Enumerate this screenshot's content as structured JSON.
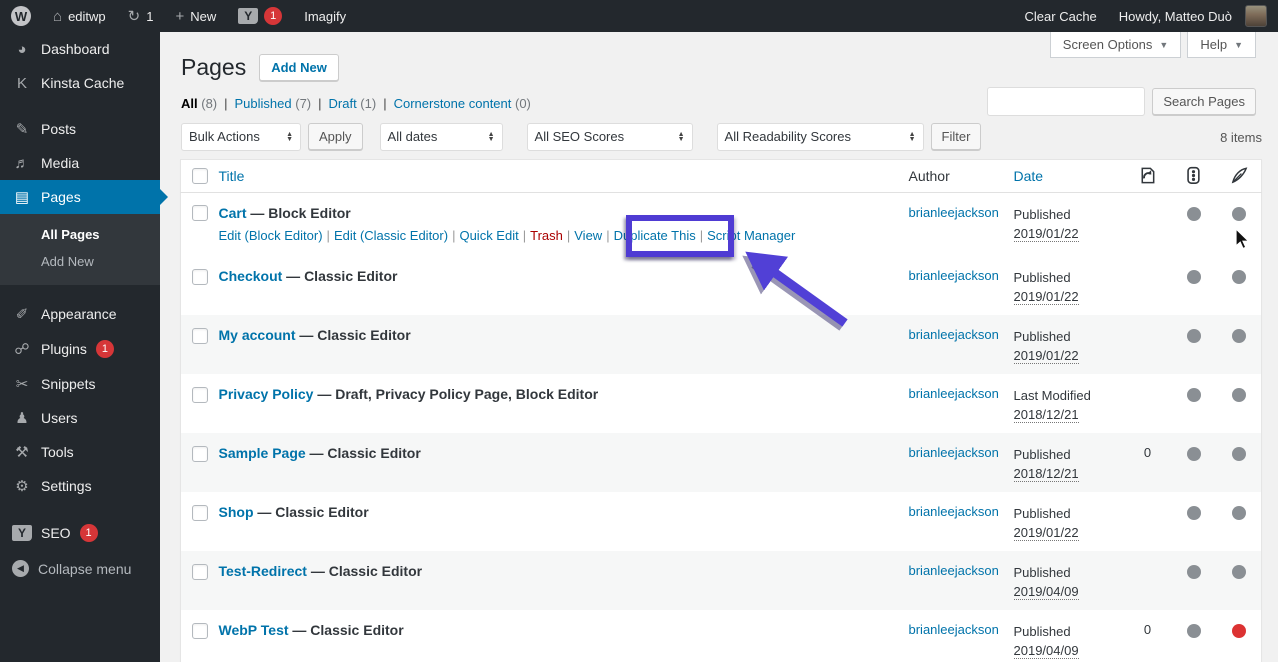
{
  "admin_bar": {
    "site_name": "editwp",
    "updates_count": "1",
    "new_label": "New",
    "yoast_count": "1",
    "imagify_label": "Imagify",
    "clear_cache_label": "Clear Cache",
    "howdy": "Howdy, Matteo Duò"
  },
  "sidebar": {
    "items": [
      {
        "label": "Dashboard",
        "glyph": "◕",
        "icon": "dashboard-icon"
      },
      {
        "label": "Kinsta Cache",
        "glyph": "K",
        "icon": "kinsta-icon"
      },
      {
        "label": "Posts",
        "glyph": "✎",
        "icon": "pushpin-icon",
        "gap": true
      },
      {
        "label": "Media",
        "glyph": "♬",
        "icon": "media-icon"
      },
      {
        "label": "Pages",
        "glyph": "▤",
        "icon": "pages-icon",
        "active": true
      },
      {
        "label": "Appearance",
        "glyph": "✐",
        "icon": "brush-icon",
        "gap": true
      },
      {
        "label": "Plugins",
        "glyph": "☍",
        "icon": "plugin-icon",
        "badge": "1"
      },
      {
        "label": "Snippets",
        "glyph": "✂",
        "icon": "scissors-icon"
      },
      {
        "label": "Users",
        "glyph": "♟",
        "icon": "user-icon"
      },
      {
        "label": "Tools",
        "glyph": "⚒",
        "icon": "wrench-icon"
      },
      {
        "label": "Settings",
        "glyph": "⚙",
        "icon": "settings-icon"
      },
      {
        "label": "SEO",
        "glyph": "Y",
        "icon": "yoast-icon",
        "badge": "1",
        "yoast": true,
        "gap": true
      },
      {
        "label": "Collapse menu",
        "glyph": "◀",
        "icon": "collapse-icon",
        "collapse": true,
        "dim": true
      }
    ],
    "submenu": [
      {
        "label": "All Pages",
        "current": true
      },
      {
        "label": "Add New",
        "current": false
      }
    ]
  },
  "header": {
    "title": "Pages",
    "add_new_label": "Add New",
    "screen_options_label": "Screen Options",
    "help_label": "Help",
    "search_button_label": "Search Pages",
    "search_value": ""
  },
  "filters": [
    {
      "label": "All",
      "count": "(8)",
      "current": true
    },
    {
      "label": "Published",
      "count": "(7)"
    },
    {
      "label": "Draft",
      "count": "(1)"
    },
    {
      "label": "Cornerstone content",
      "count": "(0)"
    }
  ],
  "toolbar": {
    "bulk_actions_label": "Bulk Actions",
    "apply_label": "Apply",
    "all_dates_label": "All dates",
    "seo_scores_label": "All SEO Scores",
    "readability_scores_label": "All Readability Scores",
    "filter_label": "Filter",
    "items_count": "8 items"
  },
  "table": {
    "headers": {
      "title": "Title",
      "author": "Author",
      "date": "Date"
    },
    "header_icons": [
      "redirect-column-icon",
      "seo-score-column-icon",
      "readability-column-icon"
    ],
    "rows": [
      {
        "title": "Cart",
        "suffix": " — Block Editor",
        "author": "brianleejackson",
        "date_status": "Published",
        "date": "2019/01/22",
        "redirects": "",
        "seo_dot": "gray",
        "readability_dot": "gray",
        "actions": [
          {
            "label": "Edit (Block Editor)"
          },
          {
            "label": "Edit (Classic Editor)"
          },
          {
            "label": "Quick Edit"
          },
          {
            "label": "Trash",
            "danger": true
          },
          {
            "label": "View"
          },
          {
            "label": "Duplicate This",
            "highlighted": true
          },
          {
            "label": "Script Manager"
          }
        ]
      },
      {
        "title": "Checkout",
        "suffix": " — Classic Editor",
        "author": "brianleejackson",
        "date_status": "Published",
        "date": "2019/01/22",
        "redirects": "",
        "seo_dot": "gray",
        "readability_dot": "gray"
      },
      {
        "title": "My account",
        "suffix": " — Classic Editor",
        "author": "brianleejackson",
        "stripe": true,
        "date_status": "Published",
        "date": "2019/01/22",
        "redirects": "",
        "seo_dot": "gray",
        "readability_dot": "gray"
      },
      {
        "title": "Privacy Policy",
        "suffix": " — Draft, Privacy Policy Page, Block Editor",
        "author": "brianleejackson",
        "date_status": "Last Modified",
        "date": "2018/12/21",
        "redirects": "",
        "seo_dot": "gray",
        "readability_dot": "gray"
      },
      {
        "title": "Sample Page",
        "suffix": " — Classic Editor",
        "author": "brianleejackson",
        "stripe": true,
        "date_status": "Published",
        "date": "2018/12/21",
        "redirects": "0",
        "seo_dot": "gray",
        "readability_dot": "gray"
      },
      {
        "title": "Shop",
        "suffix": " — Classic Editor",
        "author": "brianleejackson",
        "date_status": "Published",
        "date": "2019/01/22",
        "redirects": "",
        "seo_dot": "gray",
        "readability_dot": "gray"
      },
      {
        "title": "Test-Redirect",
        "suffix": " — Classic Editor",
        "author": "brianleejackson",
        "stripe": true,
        "date_status": "Published",
        "date": "2019/04/09",
        "redirects": "",
        "seo_dot": "gray",
        "readability_dot": "gray"
      },
      {
        "title": "WebP Test",
        "suffix": " — Classic Editor",
        "author": "brianleejackson",
        "date_status": "Published",
        "date": "2019/04/09",
        "redirects": "0",
        "seo_dot": "gray",
        "readability_dot": "red"
      }
    ]
  },
  "colors": {
    "accent_blue": "#0073aa",
    "annotation_purple": "#4f3bd3",
    "badge_red": "#d63638",
    "dot_gray": "#8a8f94",
    "dot_red": "#dc3232",
    "trash_red": "#a00000"
  }
}
